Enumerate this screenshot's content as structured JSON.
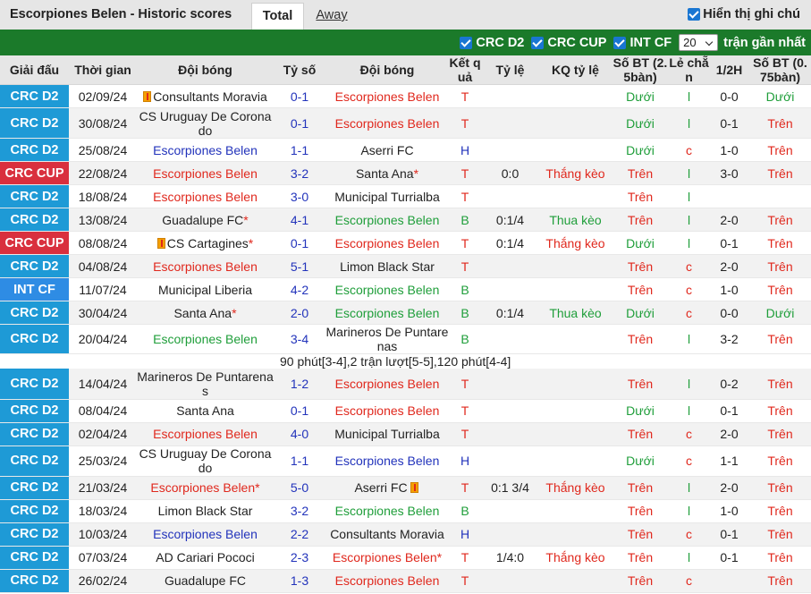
{
  "header": {
    "title": "Escorpiones Belen - Historic scores",
    "tab_total": "Total",
    "tab_away": "Away",
    "show_notes": "Hiển thị ghi chú"
  },
  "filters": {
    "f1": "CRC D2",
    "f2": "CRC CUP",
    "f3": "INT CF",
    "count_value": "20",
    "recent_label": "trận gần nhất"
  },
  "columns": {
    "league": "Giải đấu",
    "time": "Thời gian",
    "home": "Đội bóng",
    "score": "Tỷ số",
    "away": "Đội bóng",
    "result": "Kết quả",
    "odds": "Tỷ lệ",
    "odds_result": "KQ tỷ lệ",
    "goals25": "Số BT (2. 5bàn)",
    "oddeven": "Lẻ chẵn",
    "half": "1/2H",
    "goals075": "Số BT (0. 75bàn)"
  },
  "colors": {
    "crc_d2": "#1e9ad6",
    "crc_cup": "#d9303e",
    "int_cf": "#2e8ce4",
    "green_bar": "#1b7a2a",
    "win_red": "#e0281d",
    "draw_blue": "#2233bb",
    "lose_green": "#1f9e3a"
  },
  "note": "90 phút[3-4],2 trận lượt[5-5],120 phút[4-4]",
  "rows": [
    {
      "league": "CRC D2",
      "lc": "crc_d2",
      "date": "02/09/24",
      "home": "Consultants Moravia",
      "hc": "",
      "hcard": true,
      "score": "0-1",
      "away": "Escorpiones Belen",
      "ac": "red",
      "res": "T",
      "rc": "red",
      "odds": "",
      "okq": "",
      "okc": "",
      "g25": "Dưới",
      "g25c": "green",
      "oe": "l",
      "oec": "green",
      "half": "0-0",
      "g075": "Dưới",
      "g075c": "green"
    },
    {
      "league": "CRC D2",
      "lc": "crc_d2",
      "date": "30/08/24",
      "home": "CS Uruguay De Coronado",
      "hc": "",
      "wrapH": true,
      "score": "0-1",
      "away": "Escorpiones Belen",
      "ac": "red",
      "res": "T",
      "rc": "red",
      "odds": "",
      "okq": "",
      "okc": "",
      "g25": "Dưới",
      "g25c": "green",
      "oe": "l",
      "oec": "green",
      "half": "0-1",
      "g075": "Trên",
      "g075c": "red"
    },
    {
      "league": "CRC D2",
      "lc": "crc_d2",
      "date": "25/08/24",
      "home": "Escorpiones Belen",
      "hc": "blue",
      "score": "1-1",
      "away": "Aserri FC",
      "ac": "",
      "res": "H",
      "rc": "blue",
      "odds": "",
      "okq": "",
      "okc": "",
      "g25": "Dưới",
      "g25c": "green",
      "oe": "c",
      "oec": "red",
      "half": "1-0",
      "g075": "Trên",
      "g075c": "red"
    },
    {
      "league": "CRC CUP",
      "lc": "crc_cup",
      "date": "22/08/24",
      "home": "Escorpiones Belen",
      "hc": "red",
      "score": "3-2",
      "away": "Santa Ana",
      "ac": "",
      "astar": true,
      "res": "T",
      "rc": "red",
      "odds": "0:0",
      "okq": "Thắng kèo",
      "okc": "red",
      "g25": "Trên",
      "g25c": "red",
      "oe": "l",
      "oec": "green",
      "half": "3-0",
      "g075": "Trên",
      "g075c": "red"
    },
    {
      "league": "CRC D2",
      "lc": "crc_d2",
      "date": "18/08/24",
      "home": "Escorpiones Belen",
      "hc": "red",
      "score": "3-0",
      "away": "Municipal Turrialba",
      "ac": "",
      "res": "T",
      "rc": "red",
      "odds": "",
      "okq": "",
      "okc": "",
      "g25": "Trên",
      "g25c": "red",
      "oe": "l",
      "oec": "green",
      "half": "",
      "g075": "",
      "g075c": ""
    },
    {
      "league": "CRC D2",
      "lc": "crc_d2",
      "date": "13/08/24",
      "home": "Guadalupe FC",
      "hc": "",
      "hstar": true,
      "score": "4-1",
      "away": "Escorpiones Belen",
      "ac": "green",
      "res": "B",
      "rc": "green",
      "odds": "0:1/4",
      "okq": "Thua kèo",
      "okc": "green",
      "g25": "Trên",
      "g25c": "red",
      "oe": "l",
      "oec": "green",
      "half": "2-0",
      "g075": "Trên",
      "g075c": "red"
    },
    {
      "league": "CRC CUP",
      "lc": "crc_cup",
      "date": "08/08/24",
      "home": "CS Cartagines",
      "hc": "",
      "hcard": true,
      "hstar": true,
      "score": "0-1",
      "away": "Escorpiones Belen",
      "ac": "red",
      "res": "T",
      "rc": "red",
      "odds": "0:1/4",
      "okq": "Thắng kèo",
      "okc": "red",
      "g25": "Dưới",
      "g25c": "green",
      "oe": "l",
      "oec": "green",
      "half": "0-1",
      "g075": "Trên",
      "g075c": "red"
    },
    {
      "league": "CRC D2",
      "lc": "crc_d2",
      "date": "04/08/24",
      "home": "Escorpiones Belen",
      "hc": "red",
      "score": "5-1",
      "away": "Limon Black Star",
      "ac": "",
      "res": "T",
      "rc": "red",
      "odds": "",
      "okq": "",
      "okc": "",
      "g25": "Trên",
      "g25c": "red",
      "oe": "c",
      "oec": "red",
      "half": "2-0",
      "g075": "Trên",
      "g075c": "red"
    },
    {
      "league": "INT CF",
      "lc": "int_cf",
      "date": "11/07/24",
      "home": "Municipal Liberia",
      "hc": "",
      "score": "4-2",
      "away": "Escorpiones Belen",
      "ac": "green",
      "res": "B",
      "rc": "green",
      "odds": "",
      "okq": "",
      "okc": "",
      "g25": "Trên",
      "g25c": "red",
      "oe": "c",
      "oec": "red",
      "half": "1-0",
      "g075": "Trên",
      "g075c": "red"
    },
    {
      "league": "CRC D2",
      "lc": "crc_d2",
      "date": "30/04/24",
      "home": "Santa Ana",
      "hc": "",
      "hstar": true,
      "score": "2-0",
      "away": "Escorpiones Belen",
      "ac": "green",
      "res": "B",
      "rc": "green",
      "odds": "0:1/4",
      "okq": "Thua kèo",
      "okc": "green",
      "g25": "Dưới",
      "g25c": "green",
      "oe": "c",
      "oec": "red",
      "half": "0-0",
      "g075": "Dưới",
      "g075c": "green"
    },
    {
      "league": "CRC D2",
      "lc": "crc_d2",
      "date": "20/04/24",
      "home": "Escorpiones Belen",
      "hc": "green",
      "score": "3-4",
      "away": "Marineros De Puntarenas",
      "ac": "",
      "wrapA": true,
      "tall": true,
      "res": "B",
      "rc": "green",
      "odds": "",
      "okq": "",
      "okc": "",
      "g25": "Trên",
      "g25c": "red",
      "oe": "l",
      "oec": "green",
      "half": "3-2",
      "g075": "Trên",
      "g075c": "red"
    },
    {
      "league": "CRC D2",
      "lc": "crc_d2",
      "date": "14/04/24",
      "home": "Marineros De Puntarenas",
      "hc": "",
      "wrapH": true,
      "score": "1-2",
      "away": "Escorpiones Belen",
      "ac": "red",
      "res": "T",
      "rc": "red",
      "odds": "",
      "okq": "",
      "okc": "",
      "g25": "Trên",
      "g25c": "red",
      "oe": "l",
      "oec": "green",
      "half": "0-2",
      "g075": "Trên",
      "g075c": "red"
    },
    {
      "league": "CRC D2",
      "lc": "crc_d2",
      "date": "08/04/24",
      "home": "Santa Ana",
      "hc": "",
      "score": "0-1",
      "away": "Escorpiones Belen",
      "ac": "red",
      "res": "T",
      "rc": "red",
      "odds": "",
      "okq": "",
      "okc": "",
      "g25": "Dưới",
      "g25c": "green",
      "oe": "l",
      "oec": "green",
      "half": "0-1",
      "g075": "Trên",
      "g075c": "red"
    },
    {
      "league": "CRC D2",
      "lc": "crc_d2",
      "date": "02/04/24",
      "home": "Escorpiones Belen",
      "hc": "red",
      "score": "4-0",
      "away": "Municipal Turrialba",
      "ac": "",
      "res": "T",
      "rc": "red",
      "odds": "",
      "okq": "",
      "okc": "",
      "g25": "Trên",
      "g25c": "red",
      "oe": "c",
      "oec": "red",
      "half": "2-0",
      "g075": "Trên",
      "g075c": "red"
    },
    {
      "league": "CRC D2",
      "lc": "crc_d2",
      "date": "25/03/24",
      "home": "CS Uruguay De Coronado",
      "hc": "",
      "wrapH": true,
      "score": "1-1",
      "away": "Escorpiones Belen",
      "ac": "blue",
      "res": "H",
      "rc": "blue",
      "odds": "",
      "okq": "",
      "okc": "",
      "g25": "Dưới",
      "g25c": "green",
      "oe": "c",
      "oec": "red",
      "half": "1-1",
      "g075": "Trên",
      "g075c": "red"
    },
    {
      "league": "CRC D2",
      "lc": "crc_d2",
      "date": "21/03/24",
      "home": "Escorpiones Belen",
      "hc": "red",
      "hstar": true,
      "score": "5-0",
      "away": "Aserri FC",
      "ac": "",
      "acard": true,
      "res": "T",
      "rc": "red",
      "odds": "0:1 3/4",
      "okq": "Thắng kèo",
      "okc": "red",
      "g25": "Trên",
      "g25c": "red",
      "oe": "l",
      "oec": "green",
      "half": "2-0",
      "g075": "Trên",
      "g075c": "red"
    },
    {
      "league": "CRC D2",
      "lc": "crc_d2",
      "date": "18/03/24",
      "home": "Limon Black Star",
      "hc": "",
      "score": "3-2",
      "away": "Escorpiones Belen",
      "ac": "green",
      "res": "B",
      "rc": "green",
      "odds": "",
      "okq": "",
      "okc": "",
      "g25": "Trên",
      "g25c": "red",
      "oe": "l",
      "oec": "green",
      "half": "1-0",
      "g075": "Trên",
      "g075c": "red"
    },
    {
      "league": "CRC D2",
      "lc": "crc_d2",
      "date": "10/03/24",
      "home": "Escorpiones Belen",
      "hc": "blue",
      "score": "2-2",
      "away": "Consultants Moravia",
      "ac": "",
      "res": "H",
      "rc": "blue",
      "odds": "",
      "okq": "",
      "okc": "",
      "g25": "Trên",
      "g25c": "red",
      "oe": "c",
      "oec": "red",
      "half": "0-1",
      "g075": "Trên",
      "g075c": "red"
    },
    {
      "league": "CRC D2",
      "lc": "crc_d2",
      "date": "07/03/24",
      "home": "AD Cariari Pococi",
      "hc": "",
      "score": "2-3",
      "away": "Escorpiones Belen",
      "ac": "red",
      "astar": true,
      "res": "T",
      "rc": "red",
      "odds": "1/4:0",
      "okq": "Thắng kèo",
      "okc": "red",
      "g25": "Trên",
      "g25c": "red",
      "oe": "l",
      "oec": "green",
      "half": "0-1",
      "g075": "Trên",
      "g075c": "red"
    },
    {
      "league": "CRC D2",
      "lc": "crc_d2",
      "date": "26/02/24",
      "home": "Guadalupe FC",
      "hc": "",
      "score": "1-3",
      "away": "Escorpiones Belen",
      "ac": "red",
      "res": "T",
      "rc": "red",
      "odds": "",
      "okq": "",
      "okc": "",
      "g25": "Trên",
      "g25c": "red",
      "oe": "c",
      "oec": "red",
      "half": "",
      "g075": "Trên",
      "g075c": "red"
    }
  ]
}
